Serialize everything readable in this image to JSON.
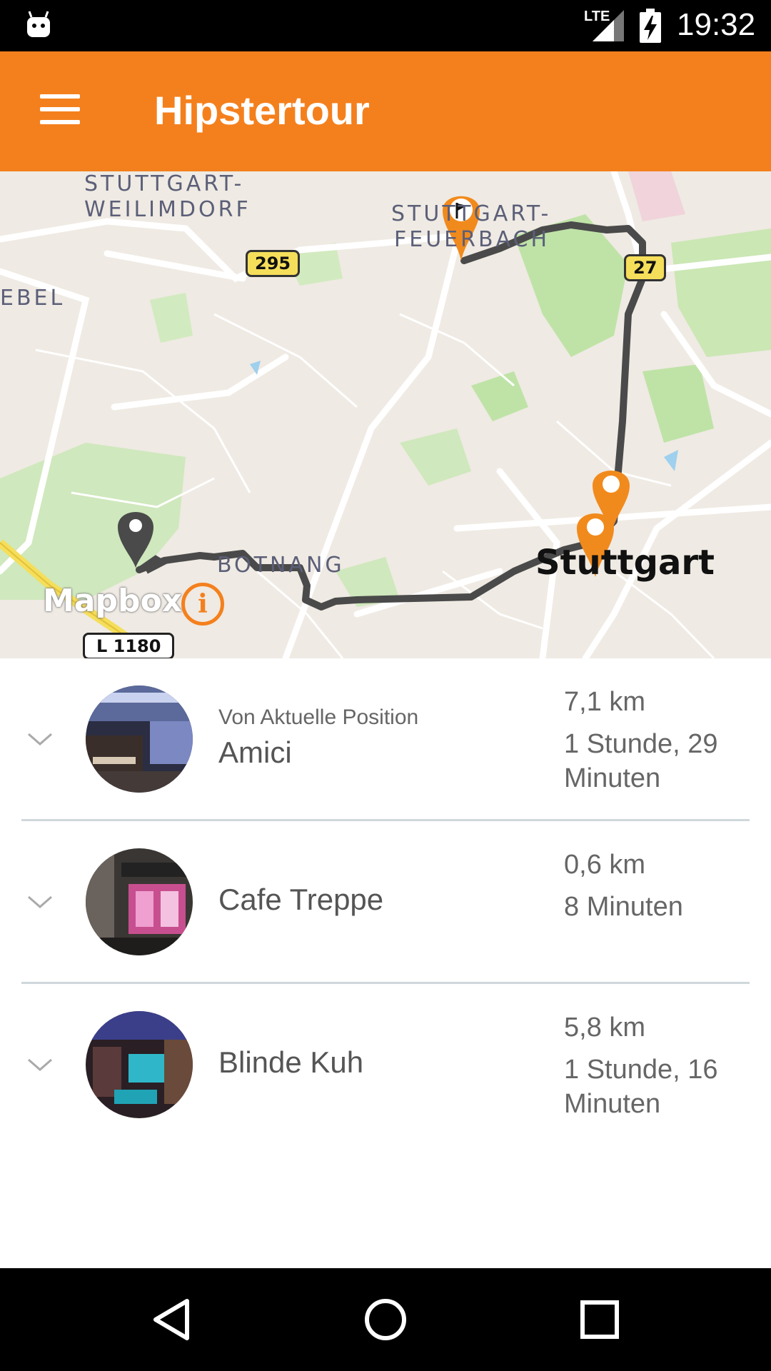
{
  "status_bar": {
    "network_label": "LTE",
    "time": "19:32",
    "icons": [
      "android-notification-icon",
      "signal-icon",
      "battery-charging-icon"
    ]
  },
  "app_bar": {
    "title": "Hipstertour",
    "menu_icon": "hamburger-menu-icon"
  },
  "map": {
    "labels": {
      "weilimdorf_1": "STUTTGART-",
      "weilimdorf_2": "WEILIMDORF",
      "feuerbach_1": "STUTTGART-",
      "feuerbach_2": "FEUERBACH",
      "gebel": "EBEL",
      "botnang": "BOTNANG",
      "city": "Stuttgart"
    },
    "road_shields": {
      "b295": "295",
      "b27": "27",
      "l1180": "L 1180"
    },
    "attribution": "Mapbox",
    "info_symbol": "i",
    "accent_color": "#f4801d",
    "route_color": "#4a4a4a"
  },
  "routes": [
    {
      "from_label": "Von Aktuelle Position",
      "name": "Amici",
      "distance": "7,1 km",
      "duration": "1 Stunde, 29 Minuten"
    },
    {
      "from_label": "",
      "name": "Cafe Treppe",
      "distance": "0,6 km",
      "duration": "8 Minuten"
    },
    {
      "from_label": "",
      "name": "Blinde Kuh",
      "distance": "5,8 km",
      "duration": "1 Stunde, 16 Minuten"
    }
  ],
  "nav_bar": {
    "icons": [
      "back-icon",
      "home-icon",
      "recents-icon"
    ]
  }
}
